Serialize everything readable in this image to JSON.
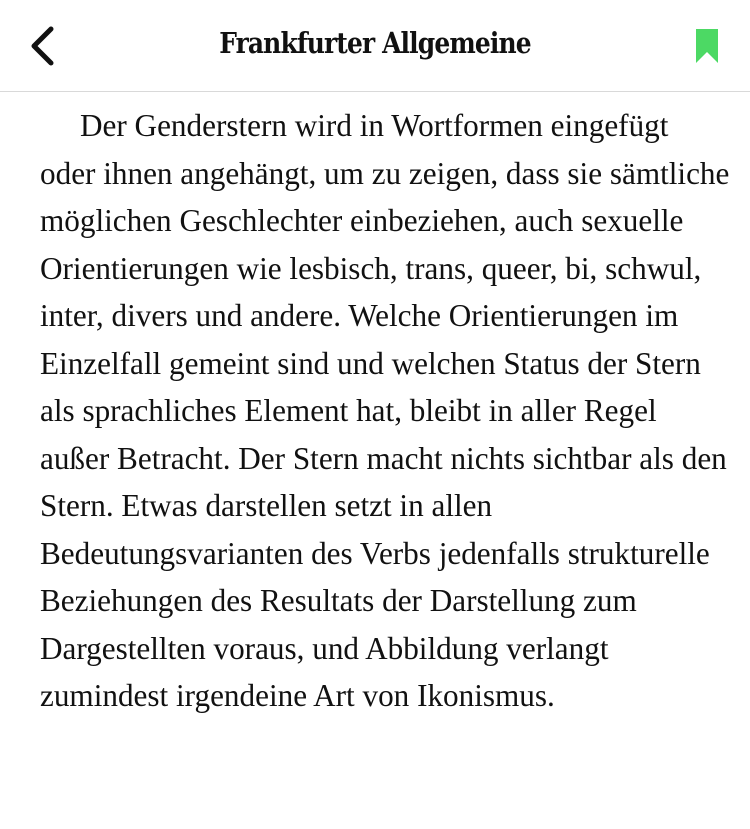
{
  "header": {
    "masthead": "Frankfurter Allgemeine",
    "back_icon": "chevron-left-icon",
    "bookmark_icon": "bookmark-icon",
    "accent_color": "#4cd964"
  },
  "article": {
    "paragraph": "Der Genderstern wird in Wortformen eingefügt oder ihnen angehängt, um zu zeigen, dass sie sämtliche möglichen Geschlechter einbeziehen, auch sexuelle Orientierungen wie lesbisch, trans, queer, bi, schwul, inter, divers und andere. Welche Orientierungen im Einzelfall gemeint sind und welchen Status der Stern als sprachliches Element hat, bleibt in aller Regel außer Betracht. Der Stern macht nichts sichtbar als den Stern. Etwas darstellen setzt in allen Bedeutungsvarianten des Verbs jedenfalls strukturelle Beziehungen des Resultats der Darstellung zum Dargestellten voraus, und Abbildung verlangt zumindest irgendeine Art von Ikonismus."
  }
}
